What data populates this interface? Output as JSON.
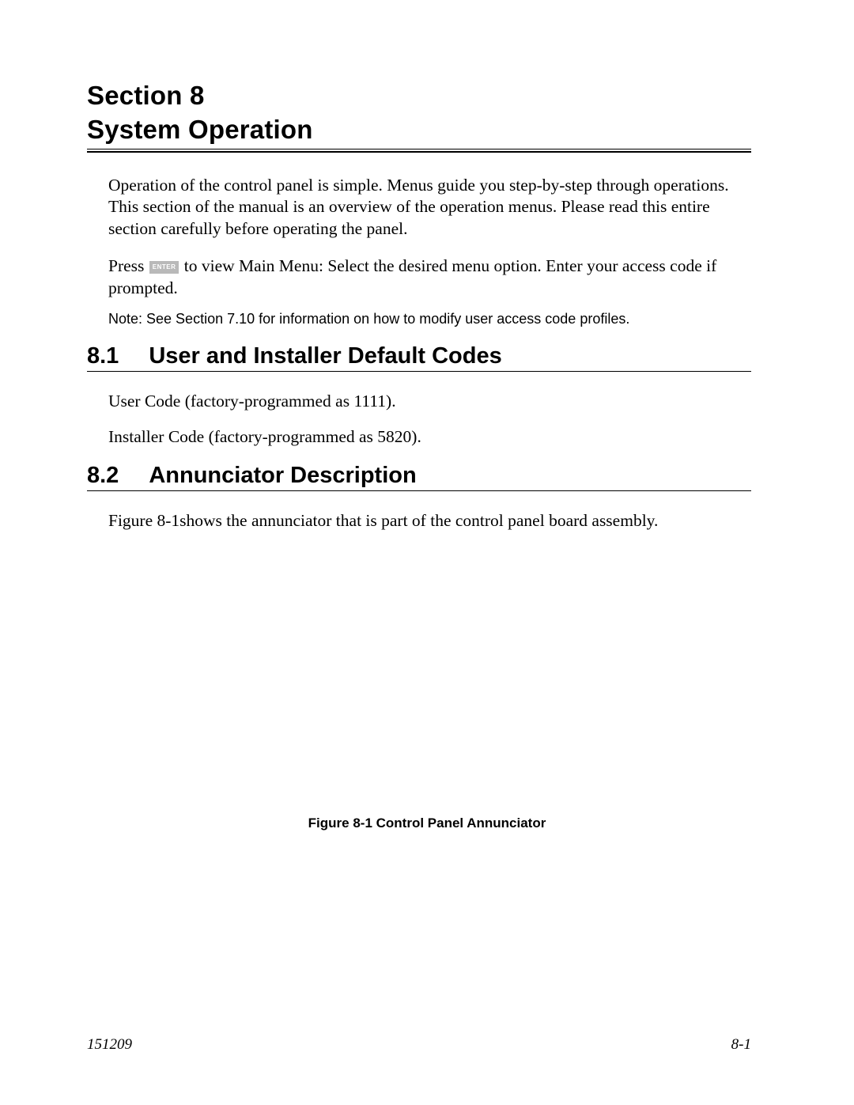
{
  "header": {
    "line1": "Section 8",
    "line2": "System Operation"
  },
  "intro": {
    "para1": "Operation of the control panel is simple. Menus guide you step-by-step through operations. This section of the manual is an overview of the operation menus. Please read this entire section carefully before operating the panel.",
    "press_prefix": "Press ",
    "enter_key": "ENTER",
    "press_suffix": " to view Main Menu: Select the desired menu option. Enter your access code if prompted.",
    "note": "Note: See Section 7.10 for information on how to modify user access code profiles."
  },
  "sub1": {
    "num": "8.1",
    "title": "User and Installer Default Codes",
    "p1": "User Code (factory-programmed as 1111).",
    "p2": "Installer Code (factory-programmed as 5820)."
  },
  "sub2": {
    "num": "8.2",
    "title": "Annunciator Description",
    "p1": "Figure 8-1shows the annunciator that is part of the control panel board assembly."
  },
  "figure": {
    "caption": "Figure 8-1  Control Panel Annunciator"
  },
  "footer": {
    "left": "151209",
    "right": "8-1"
  }
}
